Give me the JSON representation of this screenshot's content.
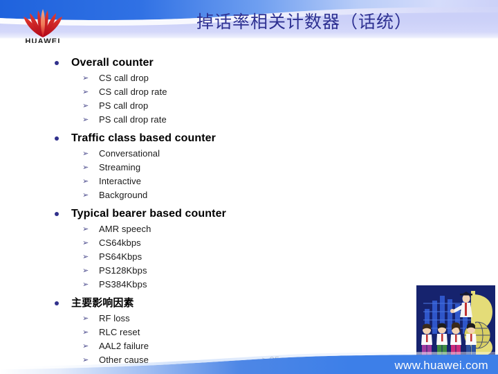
{
  "slide": {
    "title": "掉话率相关计数器（话统）",
    "page_number": "> 35",
    "brand_name": "HUAWEI",
    "footer_url": "www.huawei.com",
    "colors": {
      "header_blue": "#2f6fe0",
      "header_lavender": "#ccd1f8",
      "title_navy": "#2e3192",
      "bullet_navy": "#31318c",
      "arrow_slate": "#4a4a8c",
      "logo_red": "#cc0a1e",
      "logo_orange": "#f07a5a",
      "footer_blue": "#3d7fe8",
      "clipart_bg": "#16236e",
      "clipart_gold": "#e8e07a"
    },
    "icons": {
      "level1_bullet": "filled-circle-bullet",
      "level2_bullet": "arrowhead-bullet"
    }
  },
  "groups": [
    {
      "heading": "Overall counter",
      "cjk": false,
      "items": [
        "CS call drop",
        "CS call drop rate",
        "PS call drop",
        "PS call drop rate"
      ]
    },
    {
      "heading": "Traffic class based counter",
      "cjk": false,
      "items": [
        "Conversational",
        "Streaming",
        "Interactive",
        "Background"
      ]
    },
    {
      "heading": "Typical bearer based counter",
      "cjk": false,
      "items": [
        "AMR speech",
        "CS64kbps",
        "PS64Kbps",
        "PS128Kbps",
        "PS384Kbps"
      ]
    },
    {
      "heading": "主要影响因素",
      "cjk": true,
      "items": [
        "RF loss",
        "RLC reset",
        "AAL2 failure",
        "Other cause"
      ]
    }
  ]
}
